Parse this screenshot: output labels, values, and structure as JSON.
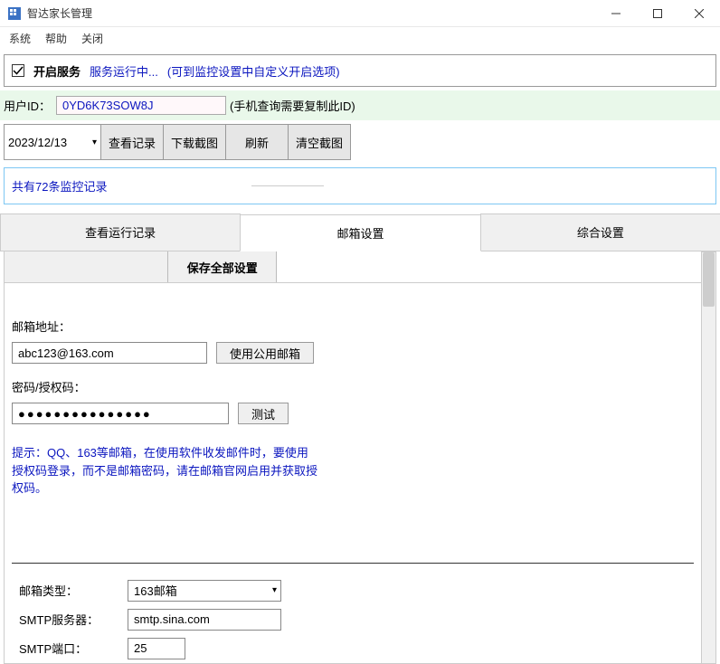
{
  "window": {
    "title": "智达家长管理",
    "menu": {
      "system": "系统",
      "help": "帮助",
      "close": "关闭"
    }
  },
  "service": {
    "enable_label": "开启服务",
    "status": "服务运行中...",
    "hint": "(可到监控设置中自定义开启选项)"
  },
  "user": {
    "label": "用户ID：",
    "id": "0YD6K73SOW8J",
    "suffix": "(手机查询需要复制此ID)"
  },
  "toolbar": {
    "date": "2023/12/13",
    "view_records": "查看记录",
    "download_shot": "下载截图",
    "refresh": "刷新",
    "clear_shot": "清空截图"
  },
  "records": {
    "count_text": "共有72条监控记录"
  },
  "tabs": {
    "run_log": "查看运行记录",
    "mail_settings": "邮箱设置",
    "general_settings": "综合设置"
  },
  "mail": {
    "save_all": "保存全部设置",
    "addr_label": "邮箱地址：",
    "addr_value": "abc123@163.com",
    "use_public": "使用公用邮箱",
    "pwd_label": "密码/授权码：",
    "pwd_value": "●●●●●●●●●●●●●●●",
    "test": "测试",
    "hint": "提示：QQ、163等邮箱，在使用软件收发邮件时，要使用授权码登录，而不是邮箱密码，请在邮箱官网启用并获取授权码。",
    "type_label": "邮箱类型：",
    "type_value": "163邮箱",
    "smtp_label": "SMTP服务器：",
    "smtp_value": "smtp.sina.com",
    "port_label": "SMTP端口：",
    "port_value": "25"
  }
}
